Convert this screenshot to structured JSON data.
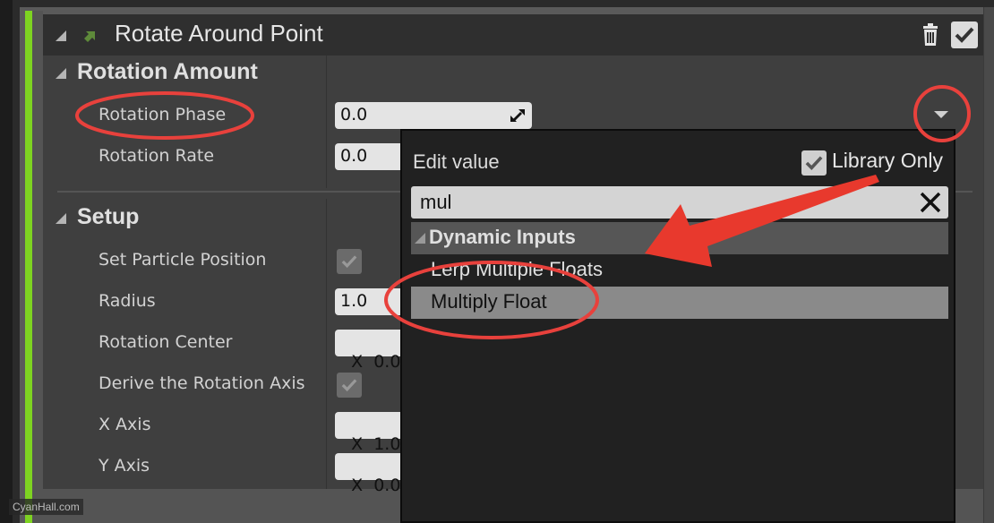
{
  "module": {
    "title": "Rotate Around Point",
    "accent_color": "#7ed321",
    "icon": "module-arrow-icon"
  },
  "sections": [
    {
      "title": "Rotation Amount",
      "properties": [
        {
          "label": "Rotation Phase",
          "type": "float",
          "value": "0.0"
        },
        {
          "label": "Rotation Rate",
          "type": "float",
          "value": "0.0"
        }
      ]
    },
    {
      "title": "Setup",
      "properties": [
        {
          "label": "Set Particle Position",
          "type": "checkbox",
          "checked": true
        },
        {
          "label": "Radius",
          "type": "float",
          "value": "1.0"
        },
        {
          "label": "Rotation Center",
          "type": "vector",
          "value": "X  0.0"
        },
        {
          "label": "Derive the Rotation Axis",
          "type": "checkbox",
          "checked": true
        },
        {
          "label": "X Axis",
          "type": "vector",
          "value": "X  1.0"
        },
        {
          "label": "Y Axis",
          "type": "vector",
          "value": "X  0.0"
        }
      ]
    }
  ],
  "popup": {
    "title": "Edit value",
    "library_only_label": "Library Only",
    "library_only_checked": true,
    "search_value": "mul",
    "category": "Dynamic Inputs",
    "items": [
      {
        "label": "Lerp Multiple Floats",
        "selected": false
      },
      {
        "label": "Multiply Float",
        "selected": true
      }
    ]
  },
  "annotation_color": "#e8413c",
  "watermark": "CyanHall.com"
}
